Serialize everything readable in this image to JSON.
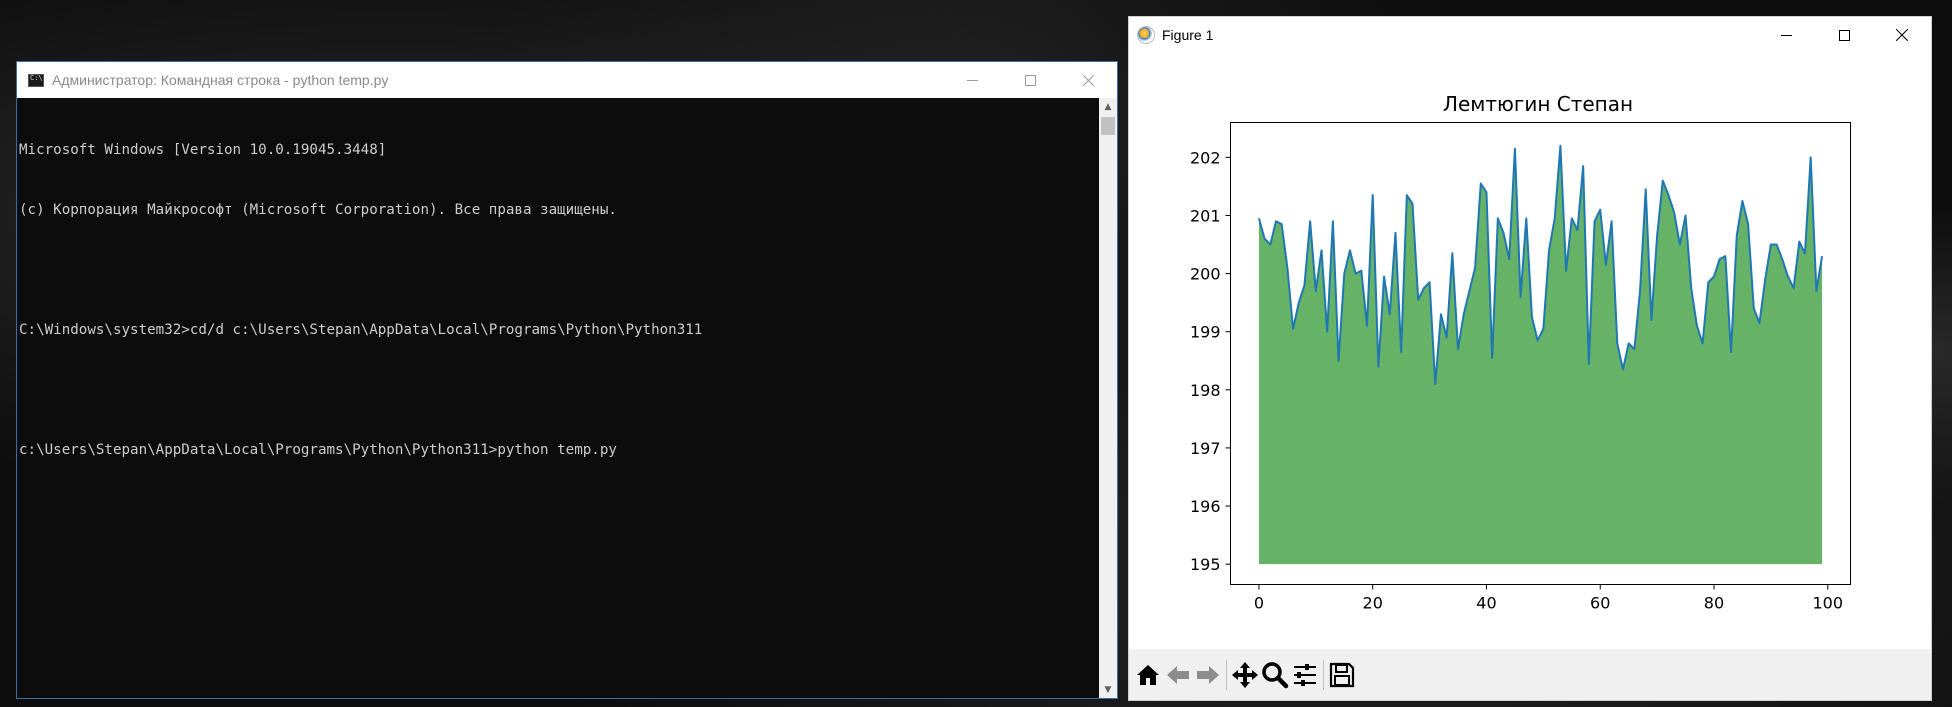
{
  "console_window": {
    "title": "Администратор: Командная строка - python  temp.py",
    "lines": [
      "Microsoft Windows [Version 10.0.19045.3448]",
      "(c) Корпорация Майкрософт (Microsoft Corporation). Все права защищены.",
      "",
      "C:\\Windows\\system32>cd/d c:\\Users\\Stepan\\AppData\\Local\\Programs\\Python\\Python311",
      "",
      "c:\\Users\\Stepan\\AppData\\Local\\Programs\\Python\\Python311>python temp.py"
    ],
    "colors": {
      "background": "#0c0c0c",
      "text": "#cccccc"
    }
  },
  "figure_window": {
    "title": "Figure 1",
    "toolbar": [
      "home-icon",
      "back-icon",
      "forward-icon",
      "pan-icon",
      "zoom-icon",
      "configure-subplots-icon",
      "save-icon"
    ]
  },
  "chart_data": {
    "type": "area",
    "title": "Лемтюгин Степан",
    "xlabel": "",
    "ylabel": "",
    "xlim": [
      -5,
      104
    ],
    "ylim": [
      194.65,
      202.6
    ],
    "xticks": [
      0,
      20,
      40,
      60,
      80,
      100
    ],
    "yticks": [
      195,
      196,
      197,
      198,
      199,
      200,
      201,
      202
    ],
    "fill_baseline": 195,
    "fill_color": "#66b266",
    "line_color": "#1f77b4",
    "grid": false,
    "series": [
      {
        "values": [
          200.95,
          200.6,
          200.5,
          200.9,
          200.85,
          200.1,
          199.05,
          199.5,
          199.8,
          200.9,
          199.7,
          200.4,
          199.0,
          200.9,
          198.5,
          200.0,
          200.4,
          200.0,
          200.05,
          199.1,
          201.35,
          198.4,
          199.95,
          199.3,
          200.7,
          198.65,
          201.35,
          201.2,
          199.55,
          199.75,
          199.85,
          198.1,
          199.3,
          198.9,
          200.35,
          198.7,
          199.3,
          199.7,
          200.1,
          201.55,
          201.4,
          198.55,
          200.95,
          200.7,
          200.25,
          202.15,
          199.6,
          200.95,
          199.25,
          198.85,
          199.05,
          200.4,
          200.95,
          202.2,
          200.05,
          200.95,
          200.75,
          201.85,
          198.45,
          200.9,
          201.1,
          200.15,
          200.9,
          198.8,
          198.35,
          198.8,
          198.7,
          199.7,
          201.45,
          199.2,
          200.65,
          201.6,
          201.35,
          201.05,
          200.5,
          201.0,
          199.75,
          199.1,
          198.8,
          199.85,
          199.95,
          200.25,
          200.3,
          198.65,
          200.65,
          201.25,
          200.85,
          199.4,
          199.15,
          199.9,
          200.5,
          200.5,
          200.25,
          199.95,
          199.75,
          200.55,
          200.35,
          202.0,
          199.7,
          200.3
        ]
      }
    ]
  }
}
